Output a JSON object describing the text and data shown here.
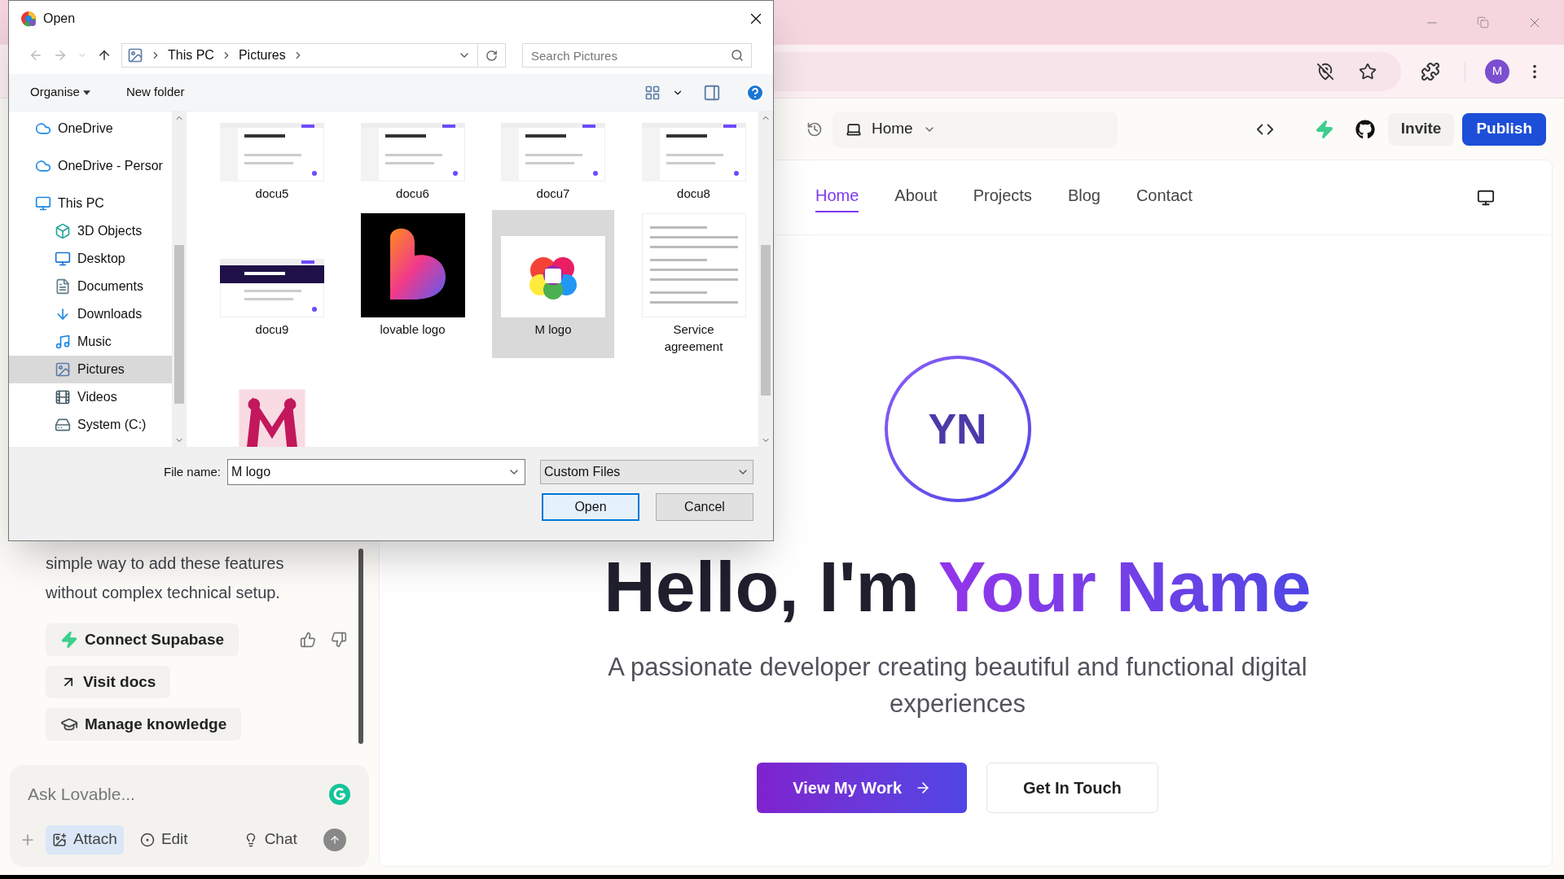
{
  "browser": {
    "profile_initial": "M"
  },
  "app_header": {
    "page_selector": "Home",
    "invite": "Invite",
    "publish": "Publish"
  },
  "chat": {
    "message": "simple way to add these features without complex technical setup.",
    "actions": [
      {
        "kind": "supabase",
        "label": "Connect Supabase"
      },
      {
        "kind": "link",
        "label": "Visit docs"
      },
      {
        "kind": "knowledge",
        "label": "Manage knowledge"
      }
    ],
    "input": {
      "placeholder": "Ask Lovable..."
    },
    "tools": [
      {
        "kind": "attach",
        "label": "Attach",
        "selected": true
      },
      {
        "kind": "edit",
        "label": "Edit",
        "selected": false
      },
      {
        "kind": "chat",
        "label": "Chat",
        "selected": false
      }
    ]
  },
  "preview": {
    "nav": [
      {
        "label": "Home",
        "selected": true
      },
      {
        "label": "About",
        "selected": false
      },
      {
        "label": "Projects",
        "selected": false
      },
      {
        "label": "Blog",
        "selected": false
      },
      {
        "label": "Contact",
        "selected": false
      }
    ],
    "avatar": "YN",
    "headline": {
      "lead": "Hello, I'm ",
      "highlight": "Your Name"
    },
    "subtitle": "A passionate developer creating beautiful and functional digital experiences",
    "buttons": [
      {
        "kind": "primary",
        "label": "View My Work"
      },
      {
        "kind": "secondary",
        "label": "Get In Touch"
      }
    ]
  },
  "dialog": {
    "title": "Open",
    "path": [
      "This PC",
      "Pictures"
    ],
    "search": {
      "placeholder": "Search Pictures"
    },
    "commands": [
      "Organise",
      "New folder"
    ],
    "sidebar": [
      {
        "kind": "cloud",
        "label": "OneDrive",
        "selected": false
      },
      {
        "kind": "cloud",
        "label": "OneDrive - Persor",
        "selected": false
      },
      {
        "kind": "computer",
        "label": "This PC",
        "selected": false,
        "children": [
          {
            "kind": "cube",
            "label": "3D Objects",
            "selected": false
          },
          {
            "kind": "desktop",
            "label": "Desktop",
            "selected": false
          },
          {
            "kind": "documents",
            "label": "Documents",
            "selected": false
          },
          {
            "kind": "download",
            "label": "Downloads",
            "selected": false
          },
          {
            "kind": "music",
            "label": "Music",
            "selected": false
          },
          {
            "kind": "pictures",
            "label": "Pictures",
            "selected": true
          },
          {
            "kind": "videos",
            "label": "Videos",
            "selected": false
          },
          {
            "kind": "drive",
            "label": "System (C:)",
            "selected": false
          }
        ]
      }
    ],
    "files": [
      {
        "name": "docu5",
        "selected": false,
        "kind": "picture"
      },
      {
        "name": "docu6",
        "selected": false,
        "kind": "picture"
      },
      {
        "name": "docu7",
        "selected": false,
        "kind": "picture"
      },
      {
        "name": "docu8",
        "selected": false,
        "kind": "picture"
      },
      {
        "name": "docu9",
        "selected": false,
        "kind": "picture"
      },
      {
        "name": "lovable logo",
        "selected": false,
        "kind": "picture"
      },
      {
        "name": "M logo",
        "selected": true,
        "kind": "picture"
      },
      {
        "name": "Service agreement",
        "selected": false,
        "kind": "picture"
      },
      {
        "selected": false,
        "kind": "picture"
      }
    ],
    "file_name_label": "File name:",
    "file_name": "M logo",
    "file_type": "Custom Files",
    "buttons": [
      {
        "label": "Open",
        "default": true
      },
      {
        "label": "Cancel",
        "default": false
      }
    ]
  }
}
